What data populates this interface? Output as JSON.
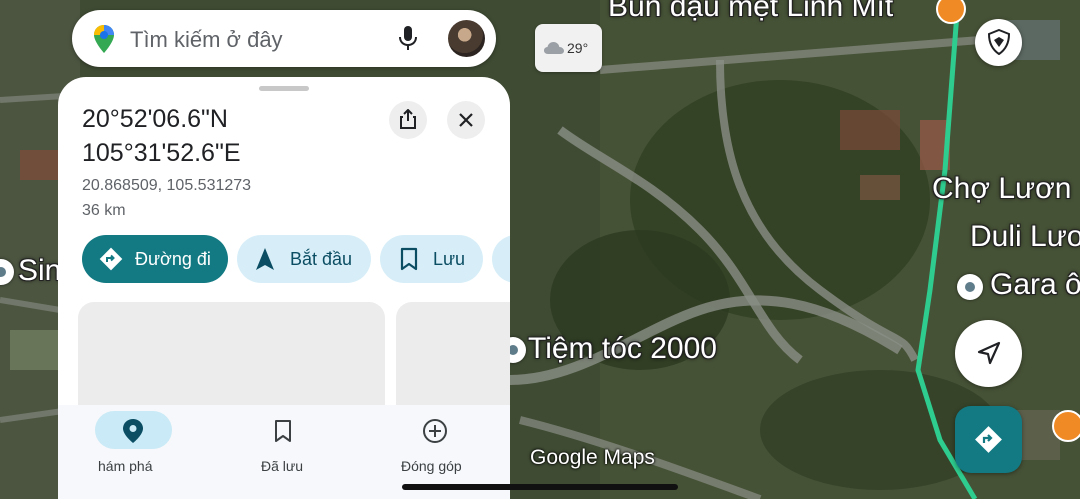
{
  "search": {
    "placeholder": "Tìm kiếm ở đây"
  },
  "weather": {
    "temperature": "29°"
  },
  "map_labels": {
    "bun_dau": "Bún đậu mẹt Linh Mít",
    "cho_luong": "Chợ Lươn",
    "duli": "Duli Lươ",
    "gara": "Gara ô",
    "tiem_toc": "Tiệm tóc 2000",
    "sin": "Sin"
  },
  "place": {
    "lat_dms": "20°52'06.6\"N",
    "lng_dms": "105°31'52.6\"E",
    "decimal": "20.868509, 105.531273",
    "distance": "36 km"
  },
  "actions": {
    "directions": "Đường đi",
    "start": "Bắt đầu",
    "save": "Lưu"
  },
  "bottom_nav": {
    "explore": "hám phá",
    "saved": "Đã lưu",
    "contribute": "Đóng góp"
  },
  "attribution": "Google Maps",
  "colors": {
    "primary": "#137a83",
    "chip_bg": "#d7eef8",
    "route": "#2ecc8f"
  }
}
